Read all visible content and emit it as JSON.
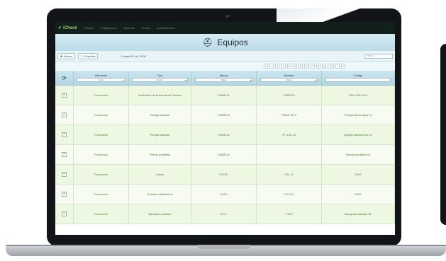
{
  "app": {
    "brand": "iCheck",
    "nav": [
      "Clases",
      "Trabajadores",
      "Asientos",
      "Zonas",
      "Administración"
    ]
  },
  "page": {
    "title": "Equipos"
  },
  "toolbar": {
    "new_label": "Nuevo",
    "export_label": "Exportar",
    "records_text": "1 hasta 10 de 2.000",
    "filter_placeholder": "Filtrar"
  },
  "pager": {
    "prev": [
      "«",
      "‹"
    ],
    "pages": [
      "1",
      "2",
      "3",
      "4",
      "5",
      "6",
      "7",
      "8",
      "9",
      "10"
    ],
    "next": [
      "›",
      "»"
    ]
  },
  "grid": {
    "columns": [
      {
        "label": "Ubicación",
        "filter": "Todos"
      },
      {
        "label": "Tipo",
        "filter": "Todos"
      },
      {
        "label": "Marca",
        "filter": "Todos"
      },
      {
        "label": "Modelo",
        "filter": "Todos"
      },
      {
        "label": "Código",
        "filter": ""
      }
    ],
    "rows": [
      [
        "Formación",
        "Verificador de Ausencia de Tensión",
        "FAMECA",
        "TORESO",
        "ERC ASC 018"
      ],
      [
        "Formación",
        "Pértiga aislante",
        "FAMECA",
        "TRIDE-MTV",
        "Pértiga telescópica 01"
      ],
      [
        "Formación",
        "Pértiga aislante",
        "FAMECA",
        "TP-12D-10",
        "pértiga salvamento 01"
      ],
      [
        "Formación",
        "Tierras portátiles",
        "FAMECA",
        "",
        "Tierras portátiles 01"
      ],
      [
        "Formación",
        "Casco",
        "SOCKI",
        "CSL 01",
        "0497"
      ],
      [
        "Formación",
        "Guantes dieléctricos",
        "CATU",
        "CG-0/3",
        "0009"
      ],
      [
        "Formación",
        "Banqueta aislante",
        "S.T.E.",
        "T.7KV",
        "Banqueta aislante 01"
      ]
    ]
  }
}
